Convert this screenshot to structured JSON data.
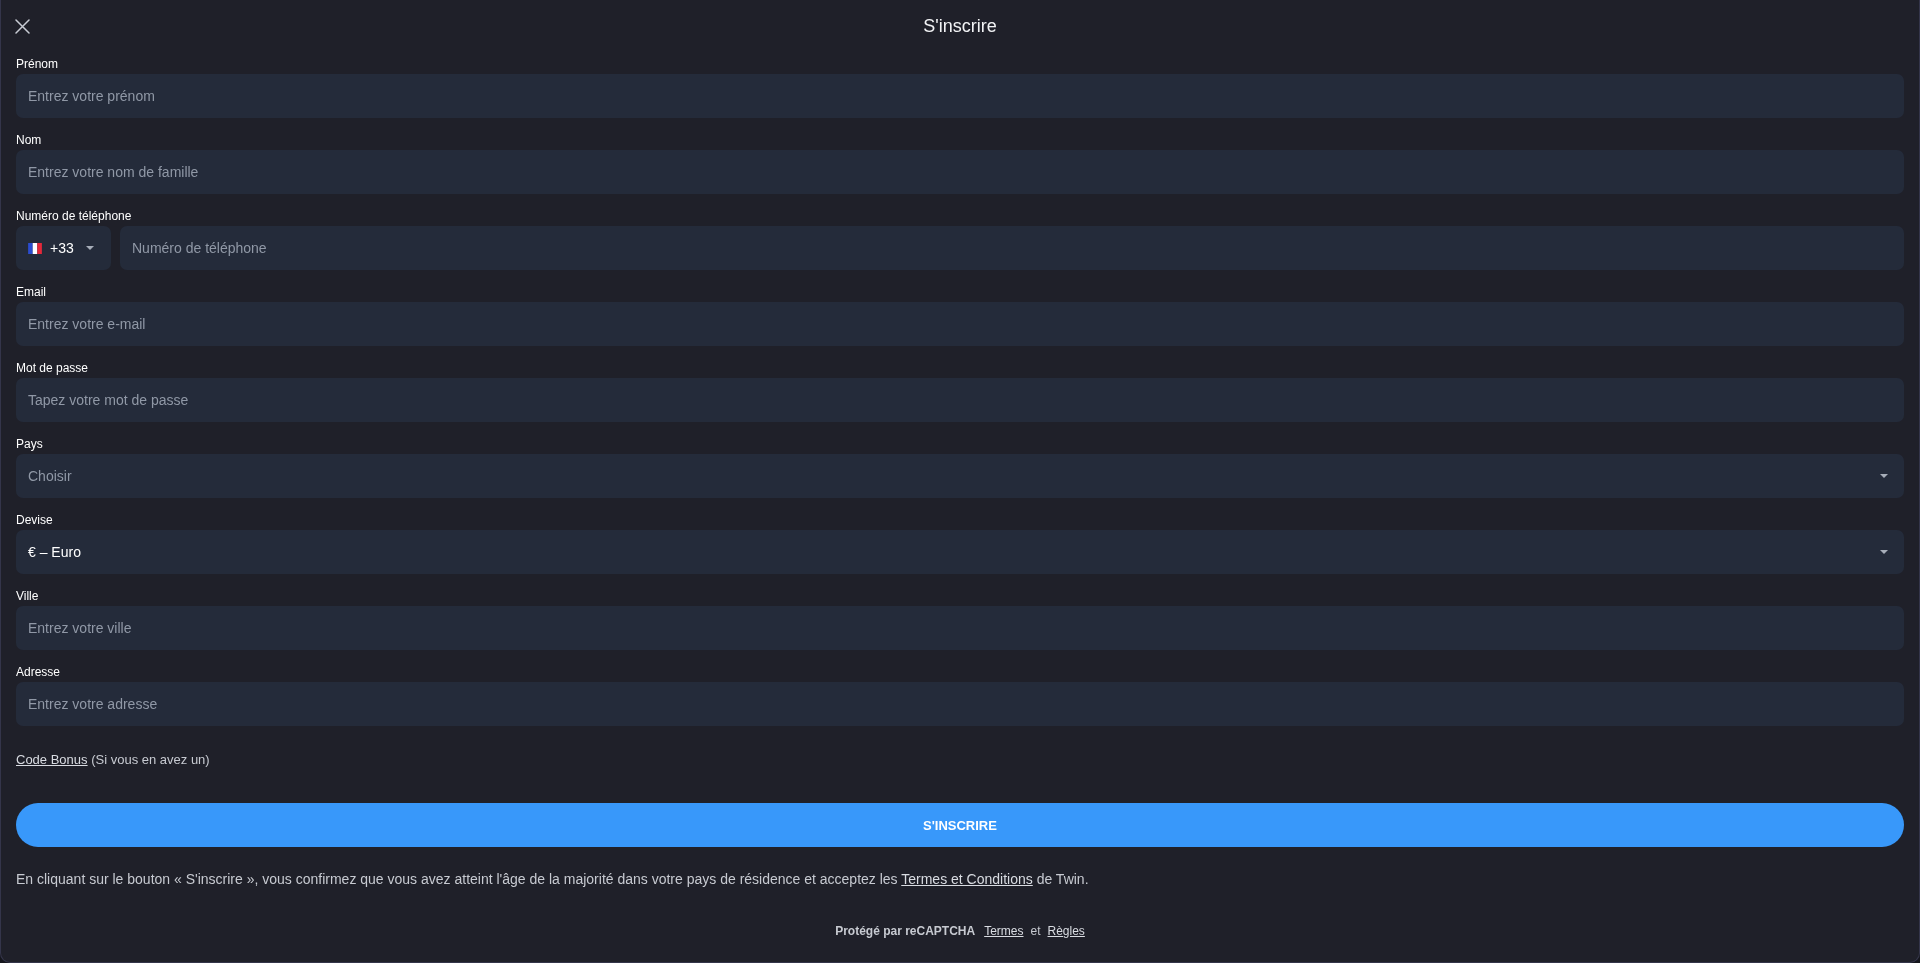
{
  "header": {
    "title": "S'inscrire"
  },
  "fields": [
    {
      "kind": "text",
      "label": "Prénom",
      "placeholder": "Entrez votre prénom"
    },
    {
      "kind": "text",
      "label": "Nom",
      "placeholder": "Entrez votre nom de famille"
    },
    {
      "kind": "phone",
      "label": "Numéro de téléphone",
      "country_code": "+33",
      "placeholder": "Numéro de téléphone"
    },
    {
      "kind": "text",
      "label": "Email",
      "placeholder": "Entrez votre e-mail"
    },
    {
      "kind": "password",
      "label": "Mot de passe",
      "placeholder": "Tapez votre mot de passe"
    },
    {
      "kind": "select",
      "label": "Pays",
      "placeholder": "Choisir"
    },
    {
      "kind": "select",
      "label": "Devise",
      "value": "€ – Euro"
    },
    {
      "kind": "text",
      "label": "Ville",
      "placeholder": "Entrez votre ville"
    },
    {
      "kind": "text",
      "label": "Adresse",
      "placeholder": "Entrez votre adresse"
    }
  ],
  "bonus": {
    "link": "Code Bonus",
    "note": "(Si vous en avez un)"
  },
  "submit_button": "S'INSCRIRE",
  "consent": {
    "text_before": "En cliquant sur le bouton « S'inscrire », vous confirmez que vous avez atteint l'âge de la majorité dans votre pays de résidence et acceptez les",
    "link": "Termes et Conditions",
    "text_after": "de Twin."
  },
  "recaptcha": {
    "text": "Protégé par reCAPTCHA",
    "terms_link": "Termes",
    "separator": "et",
    "rules_link": "Règles"
  }
}
